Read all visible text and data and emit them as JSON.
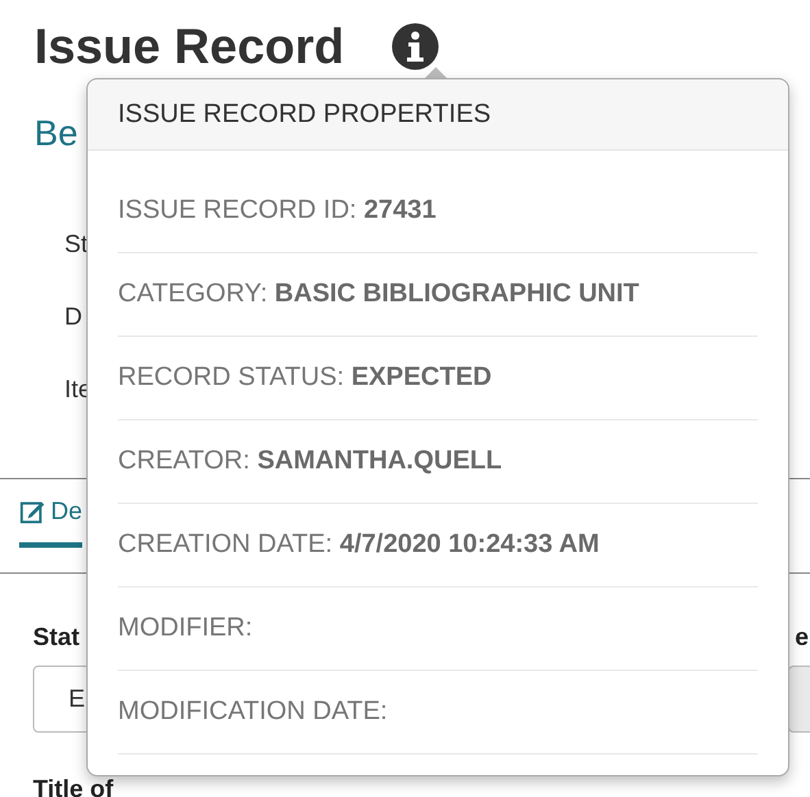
{
  "page": {
    "title": "Issue Record",
    "subtitle": "Be",
    "summary": [
      {
        "label": "St"
      },
      {
        "label": "D"
      },
      {
        "label": "Ite"
      }
    ]
  },
  "tabs": [
    {
      "label": "De",
      "selected": true
    }
  ],
  "form": {
    "left_label": "Stat",
    "left_value": "E",
    "right_label": "e",
    "next_label": "Title of"
  },
  "popover": {
    "title": "ISSUE RECORD PROPERTIES",
    "rows": [
      {
        "label": "ISSUE RECORD ID:",
        "value": "27431"
      },
      {
        "label": "CATEGORY:",
        "value": "BASIC BIBLIOGRAPHIC UNIT"
      },
      {
        "label": "RECORD STATUS:",
        "value": "EXPECTED"
      },
      {
        "label": "CREATOR:",
        "value": "SAMANTHA.QUELL"
      },
      {
        "label": "CREATION DATE:",
        "value": "4/7/2020 10:24:33 AM"
      },
      {
        "label": "MODIFIER:"
      },
      {
        "label": "MODIFICATION DATE:"
      }
    ]
  }
}
